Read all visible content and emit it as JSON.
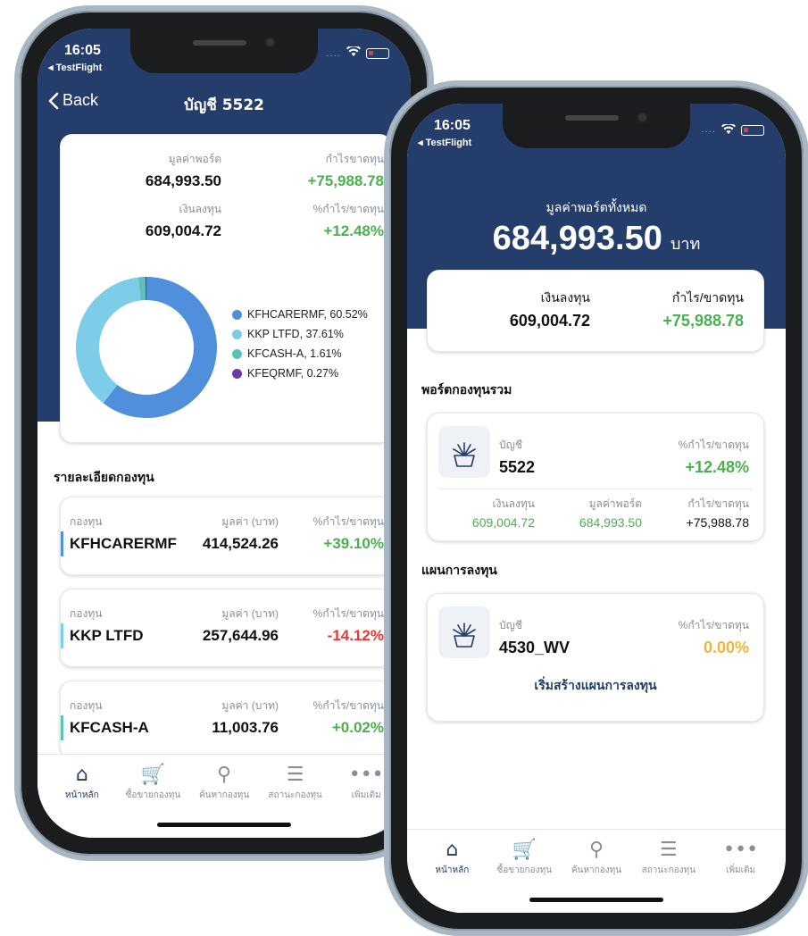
{
  "common": {
    "status_time": "16:05",
    "testflight_label": "◂ TestFlight",
    "status_dots": "....",
    "tabs": [
      {
        "label": "หน้าหลัก",
        "icon": "⌂"
      },
      {
        "label": "ซื้อขายกองทุน",
        "icon": "🛒"
      },
      {
        "label": "ค้นหากองทุน",
        "icon": "⚲"
      },
      {
        "label": "สถานะกองทุน",
        "icon": "☰"
      },
      {
        "label": "เพิ่มเติม",
        "icon": "•••"
      }
    ]
  },
  "left": {
    "back_label": "Back",
    "title": "บัญชี 5522",
    "summary": {
      "portfolio_value_label": "มูลค่าพอร์ต",
      "portfolio_value": "684,993.50",
      "profit_label": "กำไรขาดทุน",
      "profit": "+75,988.78",
      "invested_label": "เงินลงทุน",
      "invested": "609,004.72",
      "profit_pct_label": "%กำไร/ขาดทุน",
      "profit_pct": "+12.48%"
    },
    "section_title": "รายละเอียดกองทุน",
    "fund_col_fund": "กองทุน",
    "fund_col_value": "มูลค่า (บาท)",
    "fund_col_pct": "%กำไร/ขาดทุน",
    "funds": [
      {
        "name": "KFHCARERMF",
        "value": "414,524.26",
        "pct": "+39.10%",
        "color": "#4f8fdb",
        "status": "gain"
      },
      {
        "name": "KKP LTFD",
        "value": "257,644.96",
        "pct": "-14.12%",
        "color": "#7ecde8",
        "status": "loss"
      },
      {
        "name": "KFCASH-A",
        "value": "11,003.76",
        "pct": "+0.02%",
        "color": "#5cc1b6",
        "status": "gain"
      }
    ]
  },
  "chart_data": {
    "type": "pie",
    "categories": [
      "KFHCARERMF",
      "KKP LTFD",
      "KFCASH-A",
      "KFEQRMF"
    ],
    "values": [
      60.52,
      37.61,
      1.61,
      0.27
    ],
    "legend_labels": [
      "KFHCARERMF, 60.52%",
      "KKP LTFD, 37.61%",
      "KFCASH-A, 1.61%",
      "KFEQRMF, 0.27%"
    ],
    "colors": [
      "#4f8fdb",
      "#7ecde8",
      "#5cc1b6",
      "#6a3aa8"
    ],
    "legend_position": "right"
  },
  "right": {
    "total_label": "มูลค่าพอร์ตทั้งหมด",
    "total_value": "684,993.50",
    "total_unit": "บาท",
    "invested_label": "เงินลงทุน",
    "invested": "609,004.72",
    "profit_label": "กำไร/ขาดทุน",
    "profit": "+75,988.78",
    "portfolio_section": "พอร์ตกองทุนรวม",
    "account_card": {
      "account_label": "บัญชี",
      "account": "5522",
      "pct_label": "%กำไร/ขาดทุน",
      "pct": "+12.48%",
      "invested_label": "เงินลงทุน",
      "invested": "609,004.72",
      "value_label": "มูลค่าพอร์ต",
      "value": "684,993.50",
      "profit_label": "กำไร/ขาดทุน",
      "profit": "+75,988.78"
    },
    "plan_section": "แผนการลงทุน",
    "plan_card": {
      "account_label": "บัญชี",
      "account": "4530_WV",
      "pct_label": "%กำไร/ขาดทุน",
      "pct": "0.00%",
      "cta": "เริ่มสร้างแผนการลงทุน"
    }
  },
  "colors": {
    "navy": "#243d6a",
    "gain": "#4caf50",
    "loss": "#e53935",
    "neutral": "#f0b53a"
  }
}
